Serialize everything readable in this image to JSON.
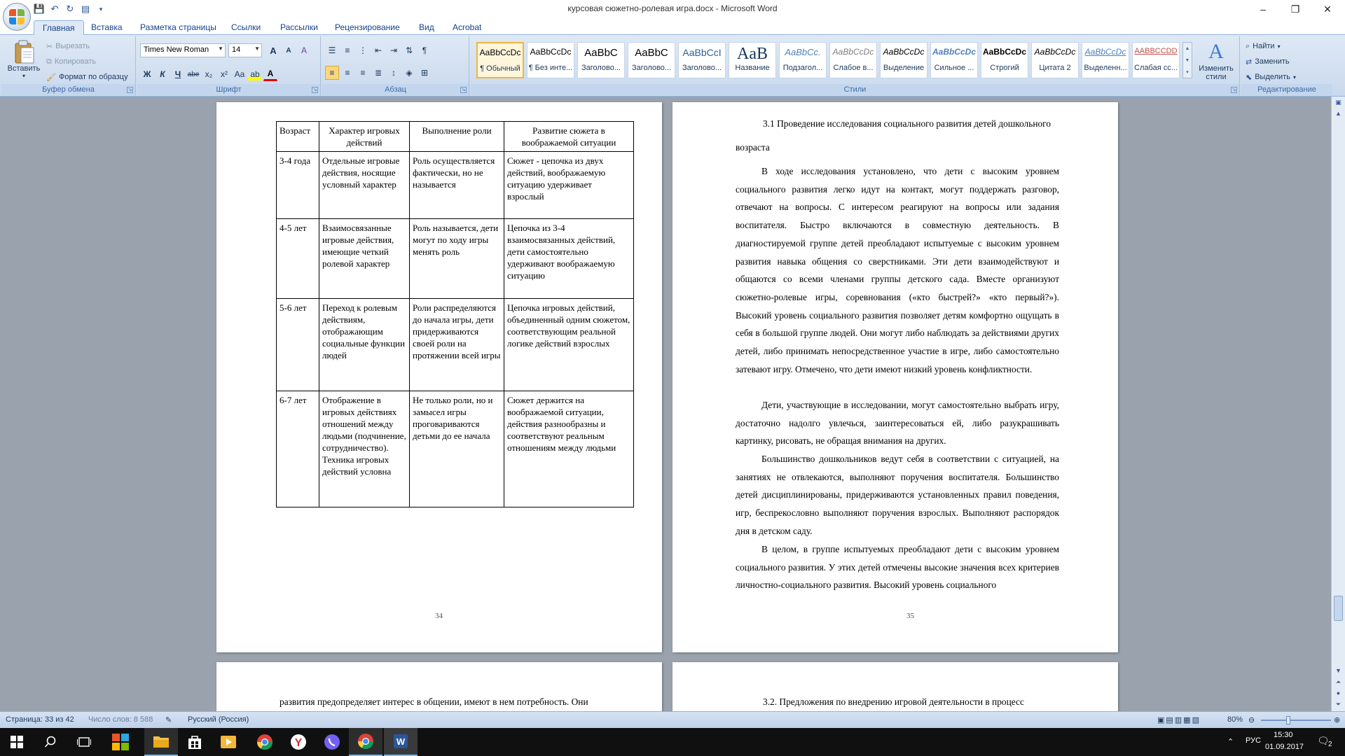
{
  "window": {
    "title": "курсовая сюжетно-ролевая игра.docx - Microsoft Word",
    "minimize": "–",
    "maximize": "❐",
    "close": "✕"
  },
  "qat": [
    "save-icon",
    "undo-icon",
    "redo-icon",
    "quick-print-icon",
    "customize-icon"
  ],
  "tabs": [
    "Главная",
    "Вставка",
    "Разметка страницы",
    "Ссылки",
    "Рассылки",
    "Рецензирование",
    "Вид",
    "Acrobat"
  ],
  "clipboard": {
    "paste": "Вставить",
    "cut": "Вырезать",
    "copy": "Копировать",
    "format_painter": "Формат по образцу",
    "label": "Буфер обмена"
  },
  "font": {
    "name": "Times New Roman",
    "size": "14",
    "label": "Шрифт",
    "bold": "Ж",
    "italic": "К",
    "underline": "Ч",
    "strike": "abe",
    "subscript": "x₂",
    "superscript": "x²",
    "change_case": "Aa",
    "grow": "A",
    "shrink": "A",
    "clear": "A"
  },
  "paragraph": {
    "label": "Абзац",
    "show_marks": "¶"
  },
  "styles": {
    "label": "Стили",
    "change": "Изменить стили",
    "items": [
      {
        "sample": "AaBbCcDc",
        "name": "¶ Обычный"
      },
      {
        "sample": "AaBbCcDc",
        "name": "¶ Без инте..."
      },
      {
        "sample": "AaBbC",
        "name": "Заголово..."
      },
      {
        "sample": "AaBbC",
        "name": "Заголово..."
      },
      {
        "sample": "AaBbCcI",
        "name": "Заголово..."
      },
      {
        "sample": "AaB",
        "name": "Название"
      },
      {
        "sample": "AaBbCc.",
        "name": "Подзагол..."
      },
      {
        "sample": "AaBbCcDc",
        "name": "Слабое в..."
      },
      {
        "sample": "AaBbCcDc",
        "name": "Выделение"
      },
      {
        "sample": "AaBbCcDc",
        "name": "Сильное ..."
      },
      {
        "sample": "AaBbCcDc",
        "name": "Строгий"
      },
      {
        "sample": "AaBbCcDc",
        "name": "Цитата 2"
      },
      {
        "sample": "AaBbCcDc",
        "name": "Выделенн..."
      },
      {
        "sample": "AABBCCDD",
        "name": "Слабая сс..."
      }
    ]
  },
  "editing": {
    "label": "Редактирование",
    "find": "Найти",
    "replace": "Заменить",
    "select": "Выделить"
  },
  "colors": {
    "ribbon": "#dfe9f5",
    "accent": "#15428b",
    "selected_style": "#f0b53d",
    "taskbar": "#101010"
  },
  "page34": {
    "number": "34",
    "table": {
      "headers": [
        "Возраст",
        "Характер игровых действий",
        "Выполнение роли",
        "Развитие сюжета в воображаемой ситуации"
      ],
      "rows": [
        [
          "3-4 года",
          "Отдельные игровые действия, носящие условный характер",
          "Роль осуществляется фактически, но не называется",
          "Сюжет - цепочка из двух действий, воображаемую ситуацию удерживает взрослый"
        ],
        [
          "4-5 лет",
          "Взаимосвязанные игровые действия, имеющие четкий ролевой характер",
          "Роль называется, дети могут по ходу игры менять роль",
          "Цепочка из 3-4 взаимосвязанных действий, дети самостоятельно удерживают воображаемую ситуацию"
        ],
        [
          "5-6 лет",
          "Переход к ролевым действиям, отображающим  социальные функции людей",
          "Роли распределяются до начала игры, дети придерживаются своей роли на протяжении всей игры",
          "Цепочка игровых действий, объединенный одним сюжетом, соответствующим реальной логике действий взрослых"
        ],
        [
          "6-7 лет",
          "Отображение в игровых действиях отношений между людьми (подчинение, сотрудничество). Техника игровых действий условна",
          "Не только роли, но и замысел игры проговариваются детьми до ее начала",
          "Сюжет держится на воображаемой ситуации, действия разнообразны и соответствуют реальным отношениям между людьми"
        ]
      ]
    }
  },
  "page35": {
    "number": "35",
    "heading_line1": "3.1 Проведение исследования социального развития детей дошкольного",
    "heading_line2": "возраста",
    "paragraphs": [
      "В ходе исследования установлено, что дети с высоким уровнем социального развития легко идут на контакт, могут поддержать разговор, отвечают на вопросы. С интересом реагируют на вопросы или задания воспитателя. Быстро включаются в совместную деятельность. В диагностируемой группе детей преобладают испытуемые с высоким уровнем развития навыка общения со сверстниками. Эти дети взаимодействуют и общаются со всеми членами группы детского сада. Вместе организуют сюжетно-ролевые игры, соревнования («кто быстрей?» «кто первый?»). Высокий уровень социального развития позволяет детям комфортно ощущать в себя в большой группе людей. Они могут либо наблюдать за действиями других детей, либо принимать непосредственное участие в игре, либо самостоятельно затевают игру. Отмечено, что дети имеют низкий уровень конфликтности.",
      "Дети, участвующие в исследовании, могут самостоятельно выбрать игру, достаточно надолго увлечься, заинтересоваться ей, либо разукрашивать картинку, рисовать, не обращая внимания на других.",
      "Большинство дошкольников ведут себя в соответствии с ситуацией, на занятиях не отвлекаются, выполняют поручения воспитателя. Большинство детей дисциплинированы, придерживаются установленных правил поведения, игр, беспрекословно выполняют поручения взрослых. Выполняют распорядок дня в детском саду.",
      "В целом, в группе испытуемых преобладают дети с высоким уровнем социального развития. У этих детей отмечены высокие значения всех критериев личностно-социального развития. Высокий уровень социального"
    ]
  },
  "page36_partial": "развития предопределяет интерес в общении, имеют в нем потребность. Они",
  "page37_partial": "3.2. Предложения по внедрению игровой деятельности в процесс",
  "status": {
    "page": "Страница: 33 из 42",
    "words": "Число слов: 8 588",
    "language": "Русский (Россия)",
    "zoom": "80%"
  },
  "taskbar": {
    "lang": "РУС",
    "time": "15:30",
    "date": "01.09.2017",
    "notifications": "2"
  }
}
